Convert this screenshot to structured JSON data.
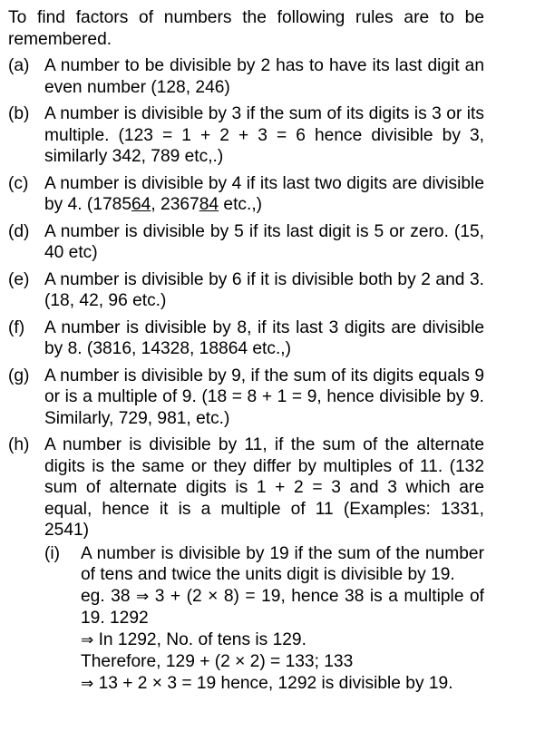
{
  "intro": "To find factors of numbers the following rules are to be remembered.",
  "rules": [
    {
      "label": "(a)",
      "text": "A number to be divisible by 2 has to have its last digit an even number (128, 246)"
    },
    {
      "label": "(b)",
      "text": "A number is divisible by 3 if the sum of its digits is 3 or its multiple. (123 = 1 + 2 + 3 = 6 hence divisible by 3, similarly 342, 789 etc,.)"
    },
    {
      "label": "(c)",
      "text_a": "A number is divisible by 4 if its last two digits are divisible by 4. (1785",
      "u1": "64",
      "text_b": ", 2367",
      "u2": "84",
      "text_c": " etc.,)"
    },
    {
      "label": "(d)",
      "text": "A number is divisible by 5 if its last digit is 5 or zero. (15, 40 etc)"
    },
    {
      "label": "(e)",
      "text": "A number is divisible by 6 if it is divisible both by 2 and 3. (18, 42, 96 etc.)"
    },
    {
      "label": "(f)",
      "text": "A number is divisible by 8, if its last 3 digits are divisible by 8. (3816, 14328, 18864 etc.,)"
    },
    {
      "label": "(g)",
      "text": "A number is divisible by 9, if the sum of its digits equals 9 or is a multiple of 9. (18 = 8 + 1 = 9, hence divisible by 9. Similarly, 729, 981, etc.)"
    },
    {
      "label": "(h)",
      "text": "A number is divisible by 11, if the sum of the alternate digits is the same or they differ by multiples of 11. (132 sum of alternate digits is 1 + 2 = 3 and 3 which are equal, hence it is a multiple of 11 (Examples: 1331, 2541)"
    }
  ],
  "sub": {
    "label": "(i)",
    "line1": "A number is divisible by 19 if the sum of the number of tens and twice the units digit is divisible by 19.",
    "arrow": "⇒",
    "line2_a": "eg. 38 ",
    "line2_b": " 3 + (2 × 8) = 19, hence 38 is a multiple of 19. 1292",
    "line3": " In 1292, No. of tens is 129.",
    "line4": "Therefore, 129 + (2 × 2) = 133; 133",
    "line5": " 13 + 2 × 3 = 19 hence, 1292 is divisible by 19."
  }
}
